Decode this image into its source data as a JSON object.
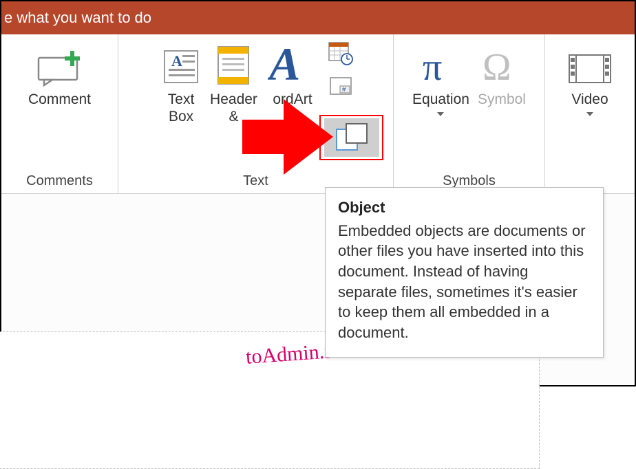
{
  "tellme": "e what you want to do",
  "groups": {
    "comments": {
      "label": "Comments",
      "comment_btn": "Comment"
    },
    "text": {
      "label": "Text",
      "textbox": "Text\nBox",
      "header": "Header\n&",
      "wordart": "ordArt",
      "date_time": "",
      "slide_number": "",
      "object": ""
    },
    "symbols": {
      "label": "Symbols",
      "equation": "Equation",
      "symbol": "Symbol"
    },
    "media": {
      "label": "",
      "video": "Video"
    }
  },
  "tooltip": {
    "title": "Object",
    "body": "Embedded objects are documents or other files you have inserted into this document. Instead of having separate files, sometimes it's easier to keep them all embedded in a document."
  },
  "watermark": "toAdmin.ru"
}
